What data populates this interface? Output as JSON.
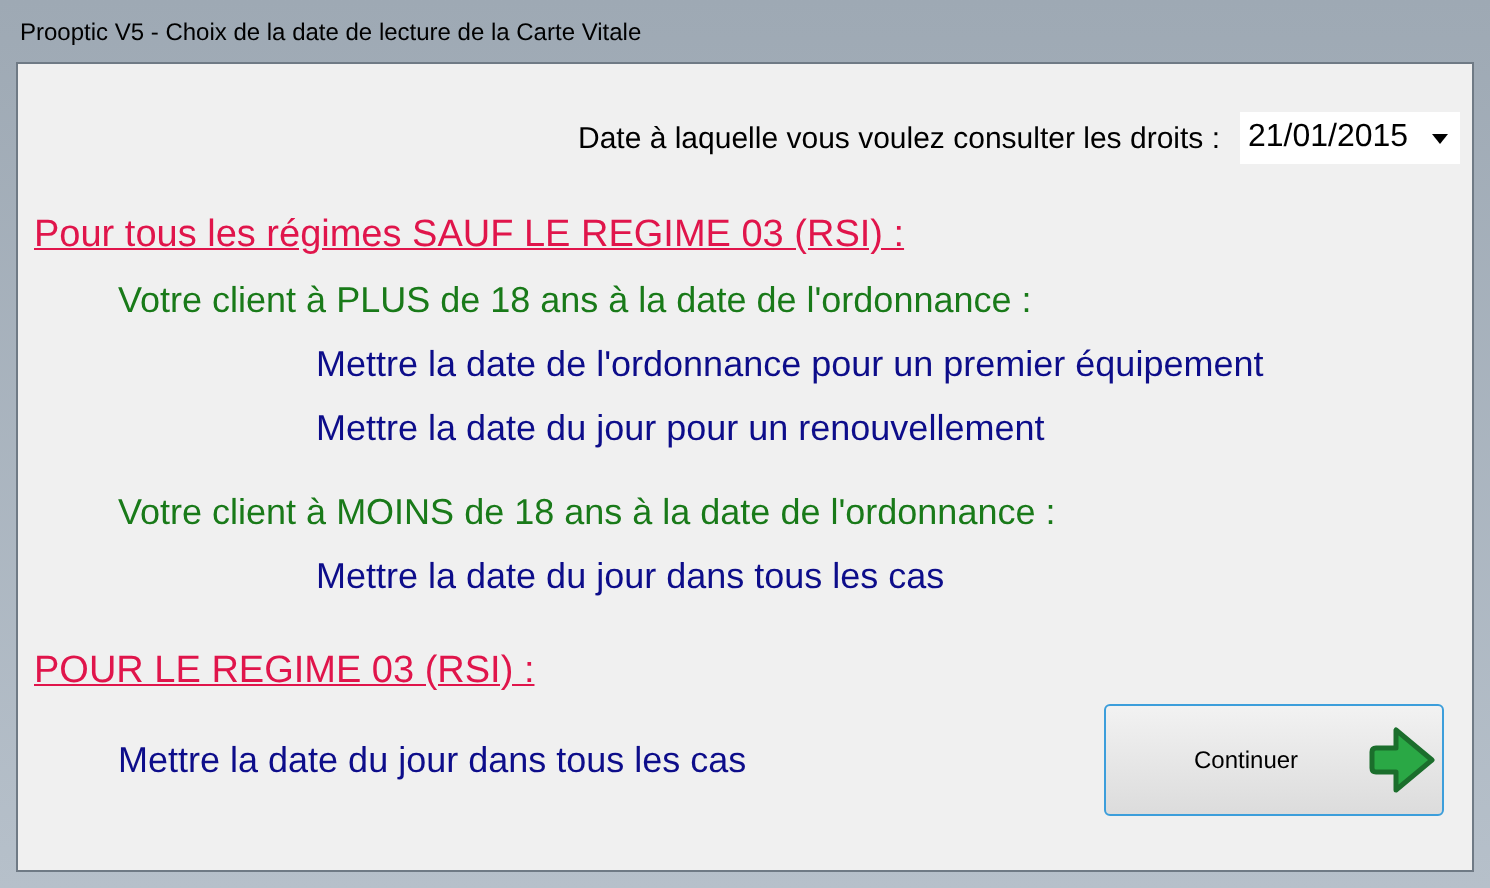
{
  "window": {
    "title": "Prooptic V5 - Choix de la date de lecture de la Carte Vitale"
  },
  "date_field": {
    "label": "Date à laquelle vous voulez consulter les droits :",
    "value": "21/01/2015"
  },
  "sections": [
    {
      "heading": "Pour tous les régimes SAUF LE REGIME 03 (RSI) :",
      "groups": [
        {
          "condition": "Votre client à PLUS de 18 ans à la date de l'ordonnance :",
          "instructions": [
            "Mettre la date de l'ordonnance pour un premier équipement",
            "Mettre la date du jour pour un renouvellement"
          ]
        },
        {
          "condition": "Votre client à MOINS de 18 ans à la date de l'ordonnance :",
          "instructions": [
            "Mettre la date du jour dans tous les cas"
          ]
        }
      ]
    },
    {
      "heading": "POUR LE REGIME 03 (RSI) :",
      "groups": [
        {
          "instructions": [
            "Mettre la date du jour dans tous les cas"
          ]
        }
      ]
    }
  ],
  "button": {
    "label": "Continuer"
  }
}
